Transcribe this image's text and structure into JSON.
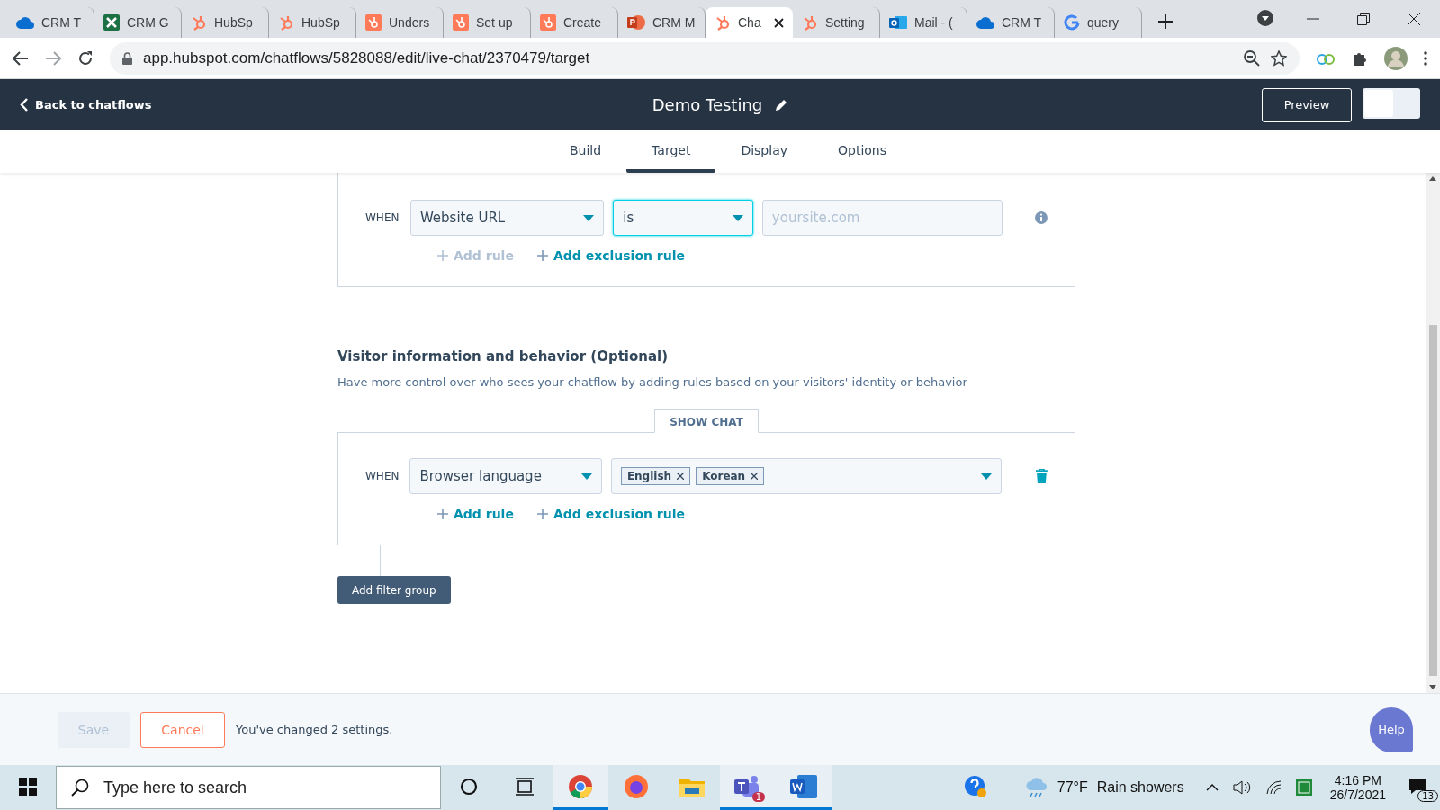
{
  "browser": {
    "tabs": [
      {
        "kind": "cloud",
        "title": "CRM T",
        "selected": false
      },
      {
        "kind": "excel",
        "title": "CRM G",
        "selected": false
      },
      {
        "kind": "hubspot",
        "title": "HubSp",
        "selected": false
      },
      {
        "kind": "hubspot",
        "title": "HubSp",
        "selected": false
      },
      {
        "kind": "hubspot-box",
        "title": "Unders",
        "selected": false
      },
      {
        "kind": "hubspot-box",
        "title": "Set up",
        "selected": false
      },
      {
        "kind": "hubspot-box",
        "title": "Create",
        "selected": false
      },
      {
        "kind": "powerpoint",
        "title": "CRM M",
        "selected": false
      },
      {
        "kind": "hubspot",
        "title": "Cha",
        "selected": true
      },
      {
        "kind": "hubspot",
        "title": "Setting",
        "selected": false
      },
      {
        "kind": "outlook",
        "title": "Mail - (",
        "selected": false
      },
      {
        "kind": "cloud",
        "title": "CRM T",
        "selected": false
      },
      {
        "kind": "google",
        "title": "query",
        "selected": false
      }
    ],
    "url": "app.hubspot.com/chatflows/5828088/edit/live-chat/2370479/target"
  },
  "header": {
    "back": "Back to chatflows",
    "title": "Demo Testing",
    "preview": "Preview",
    "toggle_on": false
  },
  "nav_tabs": [
    {
      "label": "Build",
      "selected": false
    },
    {
      "label": "Target",
      "selected": true
    },
    {
      "label": "Display",
      "selected": false
    },
    {
      "label": "Options",
      "selected": false
    }
  ],
  "groups": [
    {
      "when": "WHEN",
      "property": "Website URL",
      "operator": "is",
      "value_placeholder": "yoursite.com",
      "operator_focused": true,
      "kind": "page-rule",
      "actions": [
        {
          "label": "Add rule",
          "disabled": true
        },
        {
          "label": "Add exclusion rule",
          "disabled": false
        }
      ]
    },
    {
      "heading": "Visitor information and behavior (Optional)",
      "description": "Have more control over who sees your chatflow by adding rules based on your visitors' identity or behavior",
      "tab": "SHOW CHAT",
      "when": "WHEN",
      "property": "Browser language",
      "tags": [
        "English",
        "Korean"
      ],
      "operator_focused": false,
      "kind": "visitor-rule",
      "actions": [
        {
          "label": "Add rule",
          "disabled": false
        },
        {
          "label": "Add exclusion rule",
          "disabled": false
        }
      ]
    }
  ],
  "add_filter_group": "Add filter group",
  "footer": {
    "save": {
      "label": "Save",
      "disabled": true
    },
    "cancel": "Cancel",
    "message": "You've changed 2 settings.",
    "help": "Help"
  },
  "taskbar": {
    "search_placeholder": "Type here to search",
    "apps": [
      {
        "kind": "chrome",
        "active": true
      },
      {
        "kind": "firefox",
        "active": false
      },
      {
        "kind": "folder",
        "active": false
      },
      {
        "kind": "teams",
        "active": true,
        "badge": "1"
      },
      {
        "kind": "word",
        "active": true
      }
    ],
    "weather": "77°F",
    "weather_text": "Rain showers",
    "time": "4:16 PM",
    "date": "26/7/2021",
    "notifications": "13"
  }
}
